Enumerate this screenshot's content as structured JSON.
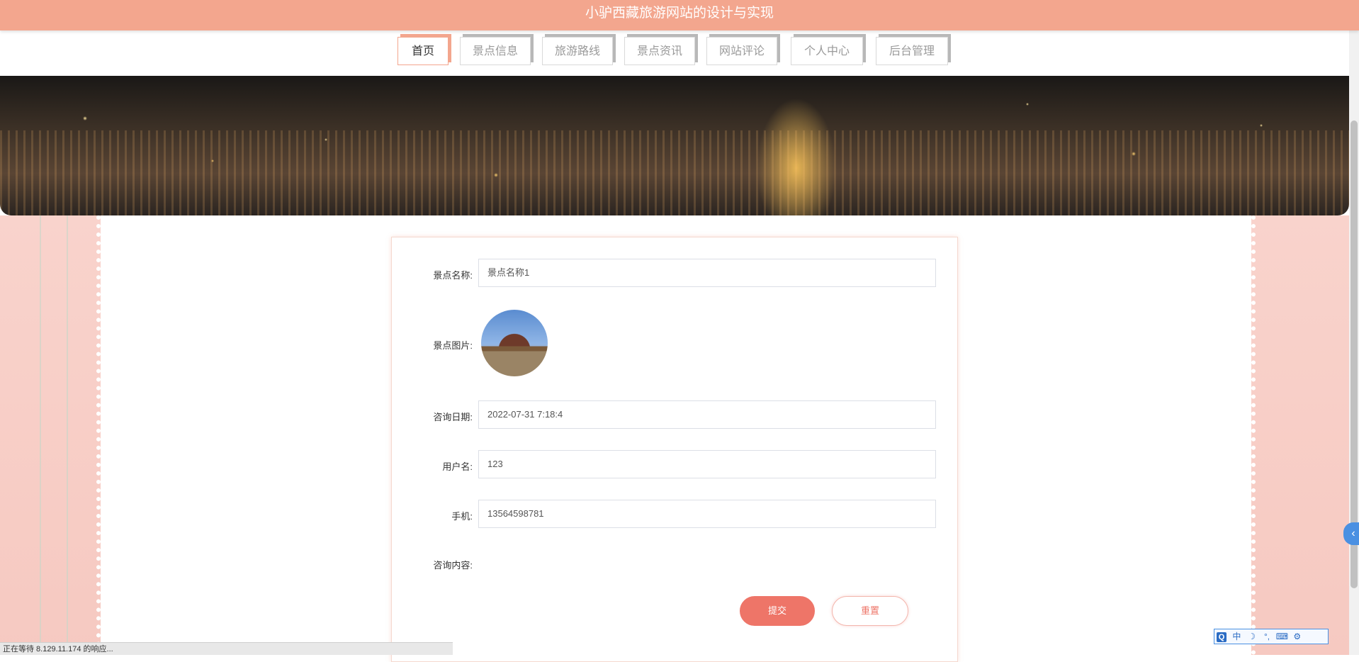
{
  "header": {
    "title": "小驴西藏旅游网站的设计与实现"
  },
  "nav": {
    "tabs": [
      {
        "label": "首页",
        "active": true
      },
      {
        "label": "景点信息",
        "active": false
      },
      {
        "label": "旅游路线",
        "active": false
      },
      {
        "label": "景点资讯",
        "active": false
      },
      {
        "label": "网站评论",
        "active": false
      },
      {
        "label": "个人中心",
        "active": false
      },
      {
        "label": "后台管理",
        "active": false
      }
    ]
  },
  "form": {
    "name_label": "景点名称:",
    "name_value": "景点名称1",
    "image_label": "景点图片:",
    "date_label": "咨询日期:",
    "date_value": "2022-07-31 7:18:4",
    "username_label": "用户名:",
    "username_value": "123",
    "phone_label": "手机:",
    "phone_value": "13564598781",
    "content_label": "咨询内容:",
    "submit_label": "提交",
    "reset_label": "重置"
  },
  "statusbar": {
    "text": "正在等待 8.129.11.174 的响应..."
  },
  "ime": {
    "logo": "Q",
    "mode": "中",
    "moon": "☽",
    "dots": "°,",
    "keyboard": "⌨",
    "tools": "⚙"
  },
  "colors": {
    "accent": "#f3a68e",
    "button": "#ee7568"
  }
}
